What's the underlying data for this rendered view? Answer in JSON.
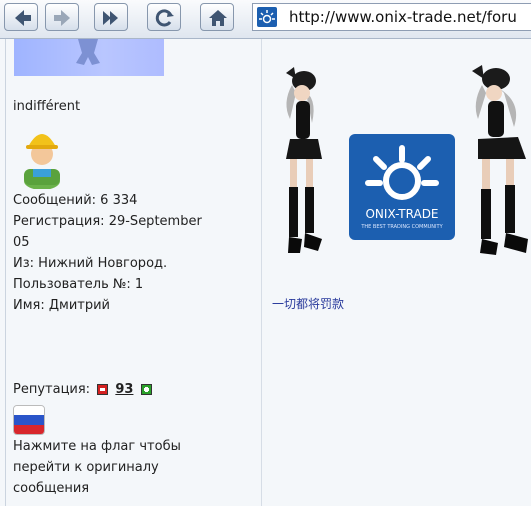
{
  "browser": {
    "url": "http://www.onix-trade.net/foru",
    "buttons": [
      "back",
      "forward",
      "history",
      "reload",
      "home"
    ]
  },
  "post": {
    "username": "indifférent",
    "messages_label": "Сообщений:",
    "messages_value": "6 334",
    "registration_label": "Регистрация:",
    "registration_value": "29-September",
    "registration_year": "05",
    "location_label": "Из:",
    "location_value": "Нижний Новгород.",
    "user_no_label": "Пользователь №:",
    "user_no_value": "1",
    "name_label": "Имя:",
    "name_value": "Дмитрий",
    "reputation_label": "Репутация:",
    "reputation_value": "93",
    "flag_hint_line1": "Нажмите на флаг чтобы",
    "flag_hint_line2": "перейти к оригиналу",
    "flag_hint_line3": "сообщения"
  },
  "signature": {
    "logo_text": "ONIX-TRADE",
    "logo_tagline": "THE BEST TRADING COMMUNITY",
    "caption": "一切都将罚款"
  },
  "colors": {
    "toolbar_bg": "#e6ecf3",
    "page_bg": "#f4f7fa",
    "logo_blue": "#1c5fb0",
    "link_blue": "#2a3b9c"
  }
}
